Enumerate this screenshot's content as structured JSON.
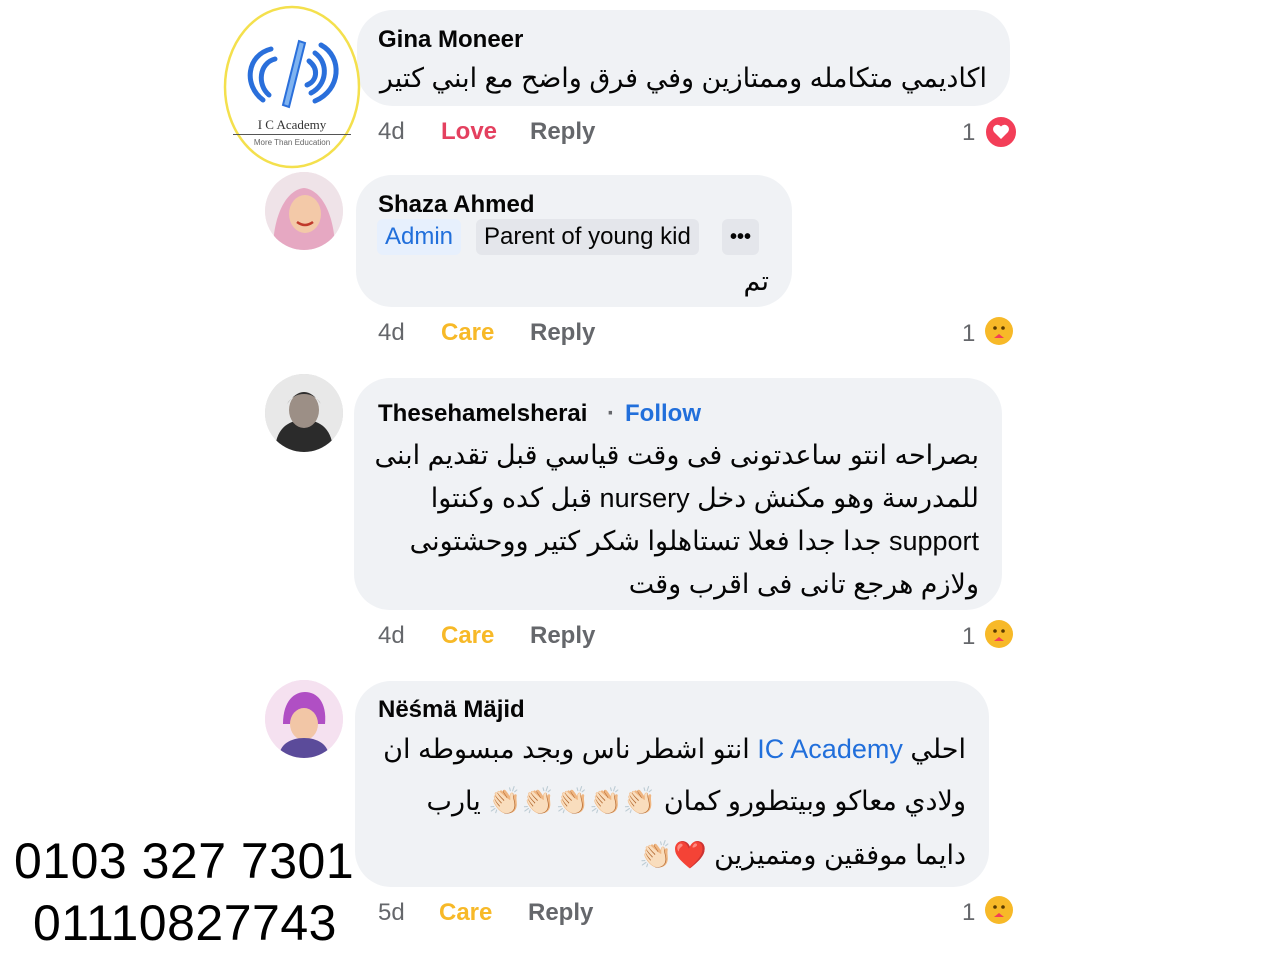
{
  "logo": {
    "name": "I C Academy",
    "tagline": "More Than Education"
  },
  "comments": [
    {
      "author": "Gina Moneer",
      "lines": [
        "اكاديمي متكامله وممتازين وفي فرق واضح مع ابني كتير"
      ],
      "time": "4d",
      "reaction_label": "Love",
      "reply_label": "Reply",
      "reaction_count": "1",
      "reaction_icon": "love-reaction-icon"
    },
    {
      "author": "Shaza Ahmed",
      "badges": [
        "Admin",
        "Parent of young kid"
      ],
      "more_label": "•••",
      "lines": [
        "تم"
      ],
      "time": "4d",
      "reaction_label": "Care",
      "reply_label": "Reply",
      "reaction_count": "1",
      "reaction_icon": "care-reaction-icon"
    },
    {
      "author": "Thesehamelsherai",
      "separator": "·",
      "follow_label": "Follow",
      "lines": [
        "بصراحه انتو ساعدتونى فى وقت قياسي قبل تقديم ابنى",
        "للمدرسة وهو مكنش دخل nursery قبل كده وكنتوا",
        "support جدا جدا فعلا تستاهلوا شكر كتير ووحشتونى",
        "ولازم هرجع تانى فى اقرب وقت"
      ],
      "time": "4d",
      "reaction_label": "Care",
      "reply_label": "Reply",
      "reaction_count": "1",
      "reaction_icon": "care-reaction-icon"
    },
    {
      "author": "Nëśmä Mäjid",
      "line1_prefix": "احلي",
      "line1_link": "IC Academy",
      "line1_suffix": "انتو اشطر ناس وبجد مبسوطه ان",
      "line2": "ولادي معاكو وبيتطورو كمان 👏🏻👏🏻👏🏻👏🏻👏🏻 يارب",
      "line3": "دايما موفقين ومتميزين ❤️👏🏻",
      "time": "5d",
      "reaction_label": "Care",
      "reply_label": "Reply",
      "reaction_count": "1",
      "reaction_icon": "care-reaction-icon"
    }
  ],
  "phones": [
    "0103 327 7301",
    "01110827743"
  ],
  "colors": {
    "bubble": "#f0f2f5",
    "love": "#e4405f",
    "care": "#f7b928",
    "link": "#216fdb",
    "logo_ring": "#f4e04d",
    "logo_blue": "#2a6fdb"
  }
}
